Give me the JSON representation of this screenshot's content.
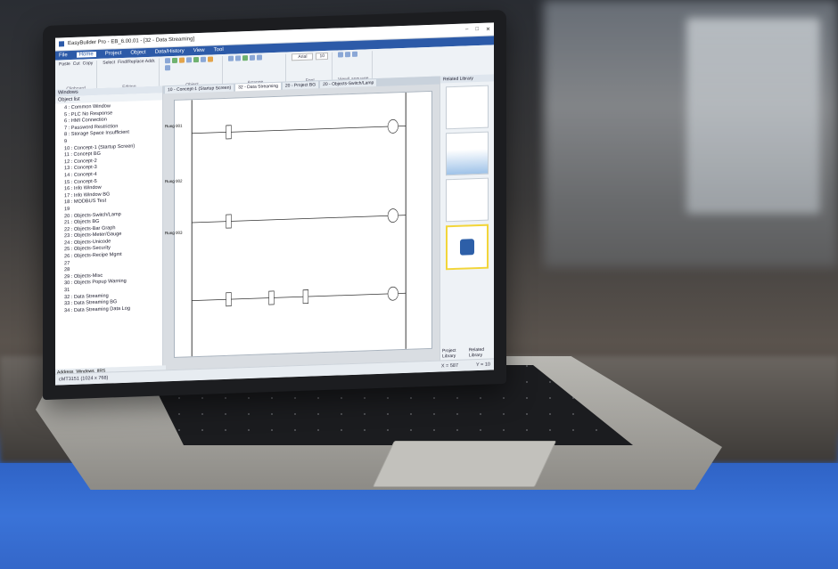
{
  "app": {
    "title": "EasyBuilder Pro - EB_6.00.01 - [32 - Data Streaming]",
    "menu": [
      "File",
      "Home",
      "Project",
      "Object",
      "Data/History",
      "View",
      "Tool"
    ],
    "active_menu": "Home",
    "ribbon_groups": [
      "Clipboard",
      "Editing",
      "Object",
      "Arrange",
      "Font",
      "View/Language"
    ],
    "ribbon_buttons": {
      "paste": "Paste",
      "cut": "Cut",
      "copy": "Copy",
      "select": "Select",
      "find": "Find/Replace Addr."
    },
    "font_name": "Arial",
    "font_size": "10"
  },
  "left_pane": {
    "title": "Windows",
    "sub_title": "Object list",
    "items": [
      "4 : Common Window",
      "5 : PLC No Response",
      "6 : HMI Connection",
      "7 : Password Restriction",
      "8 : Storage Space Insufficient",
      "9",
      "10 : Concept-1 (Startup Screen)",
      "11 : Concept BG",
      "12 : Concept-2",
      "13 : Concept-3",
      "14 : Concept-4",
      "15 : Concept-5",
      "16 : Info Window",
      "17 : Info Window BG",
      "18 : MODBUS Test",
      "19",
      "20 : Objects-Switch/Lamp",
      "21 : Objects BG",
      "22 : Objects-Bar Graph",
      "23 : Objects-Meter/Gauge",
      "24 : Objects-Unicode",
      "25 : Objects-Security",
      "26 : Objects-Recipe Mgmt",
      "27",
      "28",
      "29 : Objects-Misc",
      "30 : Objects Popup Warning",
      "31",
      "32 : Data Streaming",
      "33 : Data Streaming BG",
      "34 : Data Streaming Data Log"
    ],
    "bottom_tabs": [
      "Address",
      "Windows",
      "IIRS"
    ]
  },
  "doc_tabs": [
    "10 - Concept-1 (Startup Screen)",
    "32 - Data Streaming",
    "20 - Project BG",
    "20 - Objects-Switch/Lamp"
  ],
  "active_doc_tab": "32 - Data Streaming",
  "ladder": {
    "rungs": [
      "Rung 001",
      "Rung 002",
      "Rung 003"
    ]
  },
  "right_pane": {
    "title": "Related Library",
    "tabs": [
      "Project Library",
      "Related Library"
    ]
  },
  "status": {
    "resolution": "cMT3151 (1024 x 768)",
    "coords": [
      "X = 587",
      "Y = 10"
    ]
  }
}
